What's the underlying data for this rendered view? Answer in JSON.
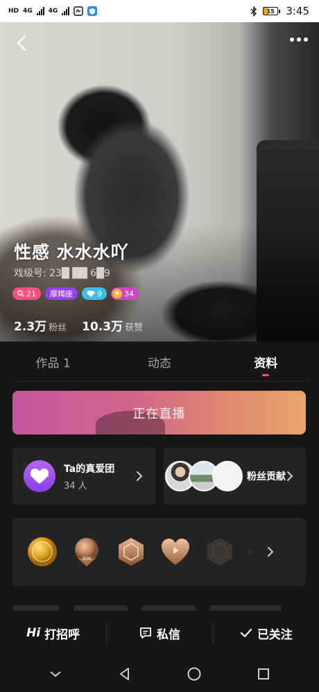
{
  "status_bar": {
    "left_labels": [
      "HD",
      "4G",
      "4G"
    ],
    "battery": "15",
    "time": "3:45"
  },
  "profile": {
    "name": "性感 水水水吖",
    "id_text": "戏级号: 23█ ██ 6█9",
    "badges": {
      "level": "21",
      "zodiac": "摩羯座",
      "diamond": "9",
      "star": "34"
    },
    "stats": [
      {
        "value": "2.3万",
        "label": "粉丝"
      },
      {
        "value": "10.3万",
        "label": "获赞"
      }
    ]
  },
  "tabs": [
    {
      "label": "作品 1",
      "active": false
    },
    {
      "label": "动态",
      "active": false
    },
    {
      "label": "资料",
      "active": true
    }
  ],
  "live_banner": {
    "text": "正在直播"
  },
  "fan_club": {
    "title": "Ta的真爱团",
    "count": "34 人"
  },
  "fan_contrib": {
    "label": "粉丝贡献"
  },
  "medals": {
    "items": [
      {
        "icon": "gold-medal-icon"
      },
      {
        "icon": "bronze-30k-medal-icon",
        "text": "30K"
      },
      {
        "icon": "bronze-hexagon-medal-icon"
      },
      {
        "icon": "bronze-heart-medal-icon"
      },
      {
        "icon": "locked-hexagon-medal-icon"
      }
    ]
  },
  "actions": [
    {
      "hi": "Hi",
      "label": "打招呼"
    },
    {
      "label": "私信"
    },
    {
      "label": "已关注"
    }
  ],
  "colors": {
    "background": "#161616",
    "card": "#242424",
    "accent": "#ff4e6a",
    "live_gradient_start": "#c4579a",
    "live_gradient_end": "#e8a569",
    "club_purple": "#9a4ef0"
  }
}
